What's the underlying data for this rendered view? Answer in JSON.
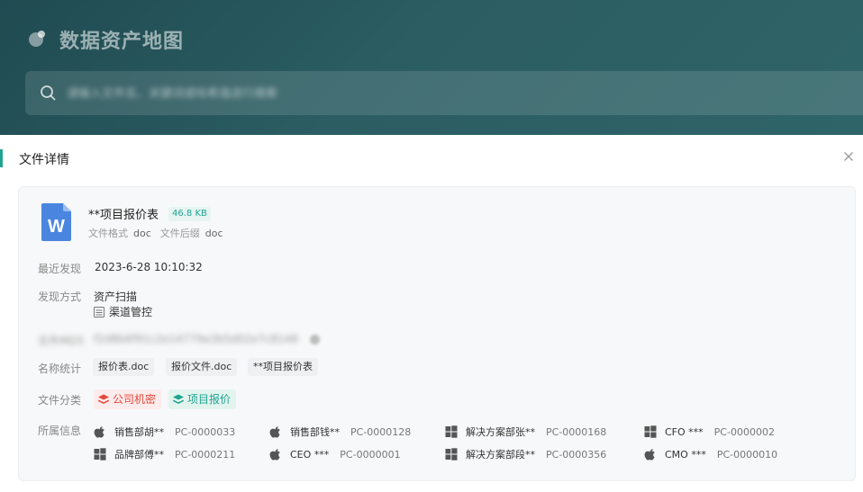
{
  "header": {
    "title": "数据资产地图",
    "search_placeholder": "请输入文件名、关键词或哈希值进行搜索"
  },
  "panel": {
    "title": "文件详情",
    "file": {
      "name": "**项目报价表",
      "size": "46.8 KB",
      "icon_letter": "W",
      "format_label": "文件格式",
      "format_value": "doc",
      "suffix_label": "文件后缀",
      "suffix_value": "doc"
    },
    "rows": {
      "discovered_label": "最近发现",
      "discovered_value": "2023-6-28 10:10:32",
      "method_label": "发现方式",
      "method_1": "资产扫描",
      "method_2": "渠道管控",
      "hash_label": "文件MD5",
      "hash_value": "f2d8b6f91c2e14779a3b5d02e7c8148",
      "names_label": "名称统计",
      "names": [
        "报价表.doc",
        "报价文件.doc",
        "**项目报价表"
      ],
      "category_label": "文件分类",
      "categories": [
        {
          "label": "公司机密",
          "color": "#e2483d"
        },
        {
          "label": "项目报价",
          "color": "#21a391"
        }
      ],
      "owner_label": "所属信息"
    },
    "devices": [
      {
        "os": "apple-icon",
        "name": "销售部胡**",
        "code": "PC-0000033"
      },
      {
        "os": "apple-icon",
        "name": "销售部钱**",
        "code": "PC-0000128"
      },
      {
        "os": "windows-icon",
        "name": "解决方案部张**",
        "code": "PC-0000168"
      },
      {
        "os": "windows-icon",
        "name": "CFO ***",
        "code": "PC-0000002"
      },
      {
        "os": "windows-icon",
        "name": "品牌部傅**",
        "code": "PC-0000211"
      },
      {
        "os": "apple-icon",
        "name": "CEO ***",
        "code": "PC-0000001"
      },
      {
        "os": "windows-icon",
        "name": "解决方案部段**",
        "code": "PC-0000356"
      },
      {
        "os": "apple-icon",
        "name": "CMO ***",
        "code": "PC-0000010"
      }
    ]
  },
  "colors": {
    "accent": "#21a391",
    "danger": "#e2483d",
    "word_blue": "#4a86e0"
  }
}
